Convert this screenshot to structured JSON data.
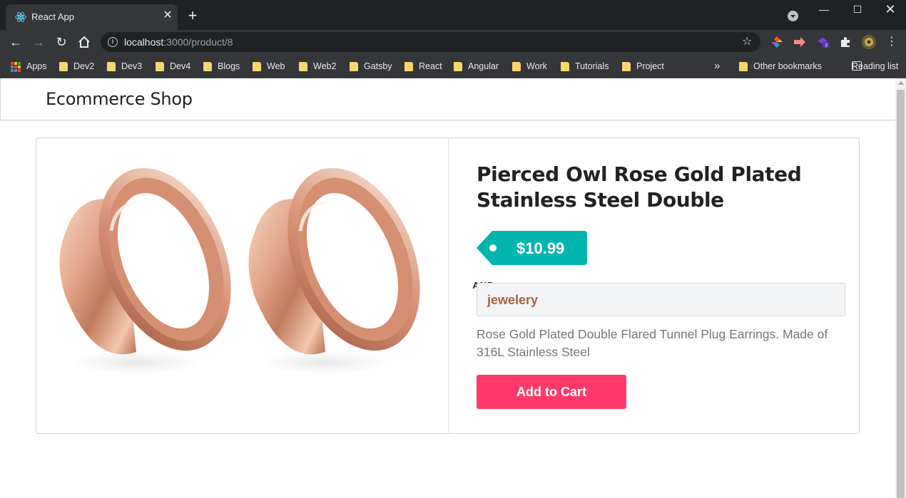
{
  "browser": {
    "tab_title": "React App",
    "url_host": "localhost",
    "url_rest": ":3000/product/8",
    "extension_badge": "3",
    "bookmarks": [
      {
        "label": "Apps",
        "type": "apps"
      },
      {
        "label": "Dev2",
        "type": "folder"
      },
      {
        "label": "Dev3",
        "type": "folder"
      },
      {
        "label": "Dev4",
        "type": "folder"
      },
      {
        "label": "Blogs",
        "type": "folder"
      },
      {
        "label": "Web",
        "type": "folder"
      },
      {
        "label": "Web2",
        "type": "folder"
      },
      {
        "label": "Gatsby",
        "type": "folder"
      },
      {
        "label": "React",
        "type": "folder"
      },
      {
        "label": "Angular",
        "type": "folder"
      },
      {
        "label": "Work",
        "type": "folder"
      },
      {
        "label": "Tutorials",
        "type": "folder"
      },
      {
        "label": "Project",
        "type": "folder"
      }
    ],
    "overflow_label": "»",
    "other_bookmarks": "Other bookmarks",
    "reading_list": "Reading list"
  },
  "header": {
    "brand": "Ecommerce Shop"
  },
  "product": {
    "title": "Pierced Owl Rose Gold Plated Stainless Steel Double",
    "price": "$10.99",
    "category": "jewelery",
    "description": "Rose Gold Plated Double Flared Tunnel Plug Earrings. Made of 316L Stainless Steel",
    "divider_label": "AND",
    "add_to_cart": "Add to Cart"
  },
  "colors": {
    "price_tag": "#00b5ad",
    "cart_button": "#ff3a6b",
    "category_text": "#a5673f",
    "rose_gold": "#e3a68a"
  }
}
